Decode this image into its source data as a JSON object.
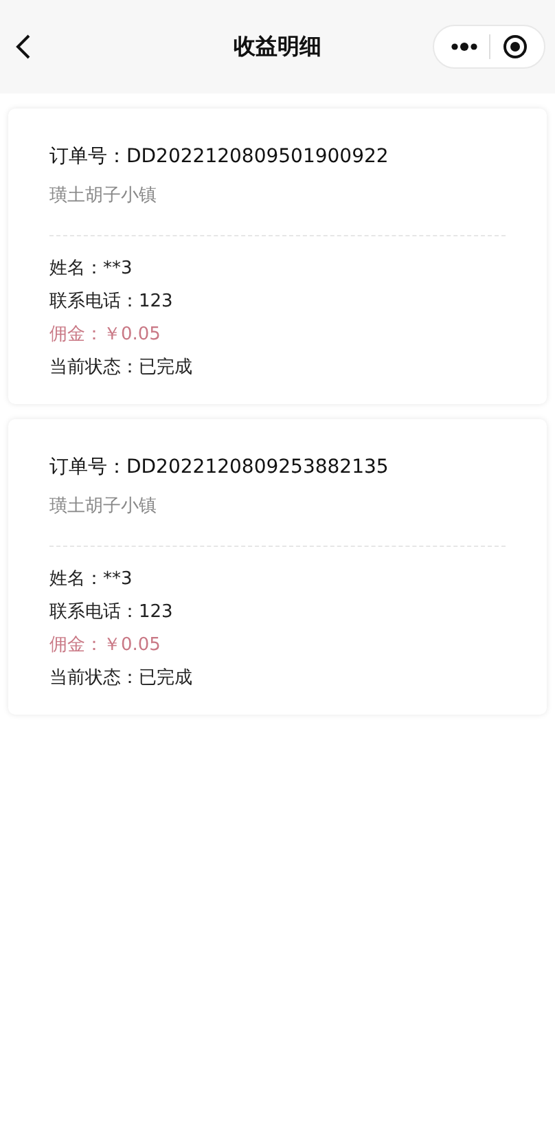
{
  "nav": {
    "title": "收益明细"
  },
  "orders": [
    {
      "order_no": "订单号：DD2022120809501900922",
      "shop": "璜土胡子小镇",
      "details": [
        {
          "text": "姓名：**3",
          "kind": "plain"
        },
        {
          "text": "联系电话：123",
          "kind": "plain"
        },
        {
          "text": "佣金：￥0.05",
          "kind": "commission"
        },
        {
          "text": "当前状态：已完成",
          "kind": "plain"
        }
      ]
    },
    {
      "order_no": "订单号：DD2022120809253882135",
      "shop": "璜土胡子小镇",
      "details": [
        {
          "text": "姓名：**3",
          "kind": "plain"
        },
        {
          "text": "联系电话：123",
          "kind": "plain"
        },
        {
          "text": "佣金：￥0.05",
          "kind": "commission"
        },
        {
          "text": "当前状态：已完成",
          "kind": "plain"
        }
      ]
    }
  ]
}
